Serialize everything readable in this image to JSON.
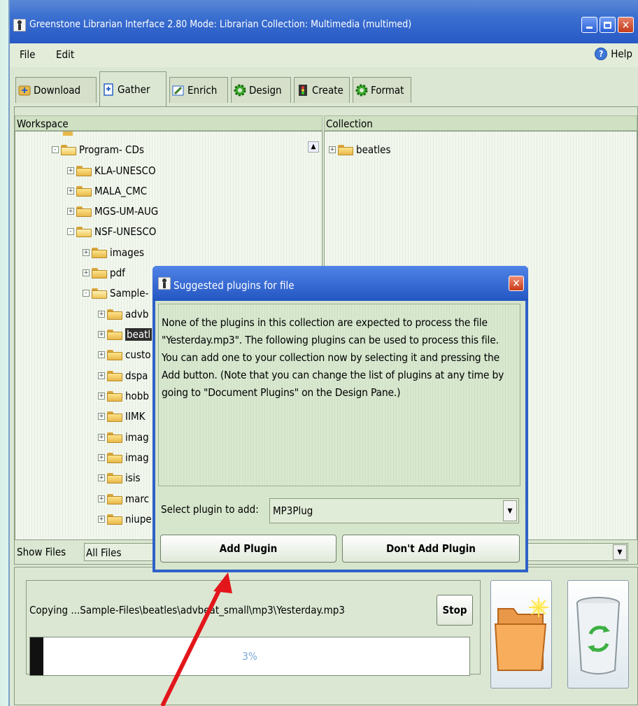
{
  "window": {
    "title": "Greenstone Librarian Interface 2.80  Mode: Librarian  Collection: Multimedia (multimed)"
  },
  "menu": {
    "file": "File",
    "edit": "Edit",
    "help": "Help"
  },
  "tabs": [
    {
      "label": "Download",
      "icon": "download-icon"
    },
    {
      "label": "Gather",
      "icon": "gather-icon",
      "active": true
    },
    {
      "label": "Enrich",
      "icon": "enrich-icon"
    },
    {
      "label": "Design",
      "icon": "design-gear-icon"
    },
    {
      "label": "Create",
      "icon": "create-icon"
    },
    {
      "label": "Format",
      "icon": "format-gear-icon"
    }
  ],
  "workspace": {
    "header": "Workspace",
    "tree": [
      {
        "label": "Program- CDs",
        "toggle": "-"
      },
      {
        "label": "KLA-UNESCO",
        "toggle": "+"
      },
      {
        "label": "MALA_CMC",
        "toggle": "+"
      },
      {
        "label": "MGS-UM-AUG",
        "toggle": "+"
      },
      {
        "label": "NSF-UNESCO",
        "toggle": "-"
      },
      {
        "label": "images",
        "toggle": "+"
      },
      {
        "label": "pdf",
        "toggle": "+"
      },
      {
        "label": "Sample-",
        "toggle": "-"
      },
      {
        "label": "advb",
        "toggle": "+"
      },
      {
        "label": "beatl",
        "toggle": "+",
        "selected": true
      },
      {
        "label": "custo",
        "toggle": "+"
      },
      {
        "label": "dspa",
        "toggle": "+"
      },
      {
        "label": "hobb",
        "toggle": "+"
      },
      {
        "label": "IIMK",
        "toggle": "+"
      },
      {
        "label": "imag",
        "toggle": "+"
      },
      {
        "label": "imag",
        "toggle": "+"
      },
      {
        "label": "isis",
        "toggle": "+"
      },
      {
        "label": "marc",
        "toggle": "+"
      },
      {
        "label": "niupe",
        "toggle": "+"
      }
    ]
  },
  "collection": {
    "header": "Collection",
    "tree": [
      {
        "label": "beatles",
        "toggle": "+"
      }
    ]
  },
  "show_files": {
    "label": "Show Files",
    "value": "All Files"
  },
  "progress": {
    "message": "Copying ...Sample-Files\\beatles\\advbeat_small\\mp3\\Yesterday.mp3",
    "stop": "Stop",
    "percent_text": "3%",
    "percent": 0.03
  },
  "dialog": {
    "title": "Suggested plugins for file",
    "message": "None of the plugins in this collection are expected to process the file \"Yesterday.mp3\". The following plugins can be used to process this file. You can add one to your collection now by selecting it and pressing the Add button. (Note that you can change the list of plugins at any time by going to \"Document Plugins\" on the Design Pane.)",
    "select_label": "Select plugin to add:",
    "selected_plugin": "MP3Plug",
    "add_button": "Add Plugin",
    "dont_add_button": "Don't Add Plugin"
  },
  "colors": {
    "titlebar": "#2859c5",
    "panel": "#dbe7d3",
    "annotation_arrow": "#e3161b"
  }
}
